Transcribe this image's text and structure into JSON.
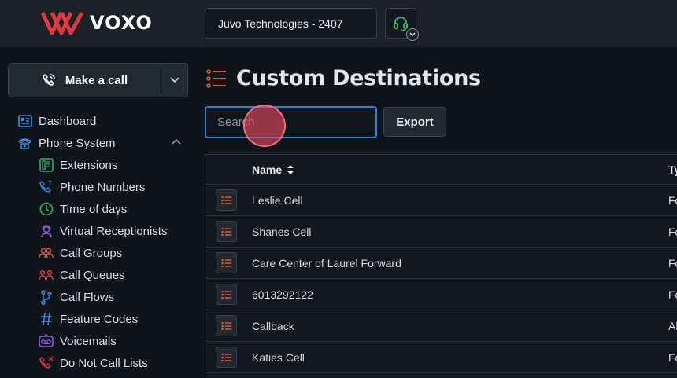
{
  "brand": {
    "name": "VOXO",
    "accent": "#e03a3e"
  },
  "header": {
    "company": "Juvo Technologies - 2407"
  },
  "sidebar": {
    "make_call": "Make a call",
    "items": [
      {
        "label": "Dashboard",
        "icon": "dashboard-icon",
        "color": "#3d8de0"
      },
      {
        "label": "Phone System",
        "icon": "phone-system-icon",
        "color": "#3d8de0"
      },
      {
        "label": "Extensions",
        "icon": "extensions-icon",
        "color": "#32b36b"
      },
      {
        "label": "Phone Numbers",
        "icon": "phone-numbers-icon",
        "color": "#3d8de0"
      },
      {
        "label": "Time of days",
        "icon": "clock-icon",
        "color": "#32b36b"
      },
      {
        "label": "Virtual Receptionists",
        "icon": "receptionist-icon",
        "color": "#9a5be0"
      },
      {
        "label": "Call Groups",
        "icon": "call-groups-icon",
        "color": "#e0553a"
      },
      {
        "label": "Call Queues",
        "icon": "call-queues-icon",
        "color": "#e03a4a"
      },
      {
        "label": "Call Flows",
        "icon": "call-flows-icon",
        "color": "#3d8de0"
      },
      {
        "label": "Feature Codes",
        "icon": "hash-icon",
        "color": "#3d8de0"
      },
      {
        "label": "Voicemails",
        "icon": "voicemail-icon",
        "color": "#9a5be0"
      },
      {
        "label": "Do Not Call Lists",
        "icon": "do-not-call-icon",
        "color": "#e03a4a"
      }
    ]
  },
  "main": {
    "title": "Custom Destinations",
    "search_placeholder": "Search",
    "export_label": "Export",
    "columns": [
      "Name",
      "Ty"
    ],
    "rows": [
      {
        "name": "Leslie Cell",
        "type": "Fo"
      },
      {
        "name": "Shanes Cell",
        "type": "Fo"
      },
      {
        "name": "Care Center of Laurel Forward",
        "type": "Fo"
      },
      {
        "name": "6013292122",
        "type": "Fo"
      },
      {
        "name": "Callback",
        "type": "Al"
      },
      {
        "name": "Katies Cell",
        "type": "Fo"
      }
    ]
  }
}
